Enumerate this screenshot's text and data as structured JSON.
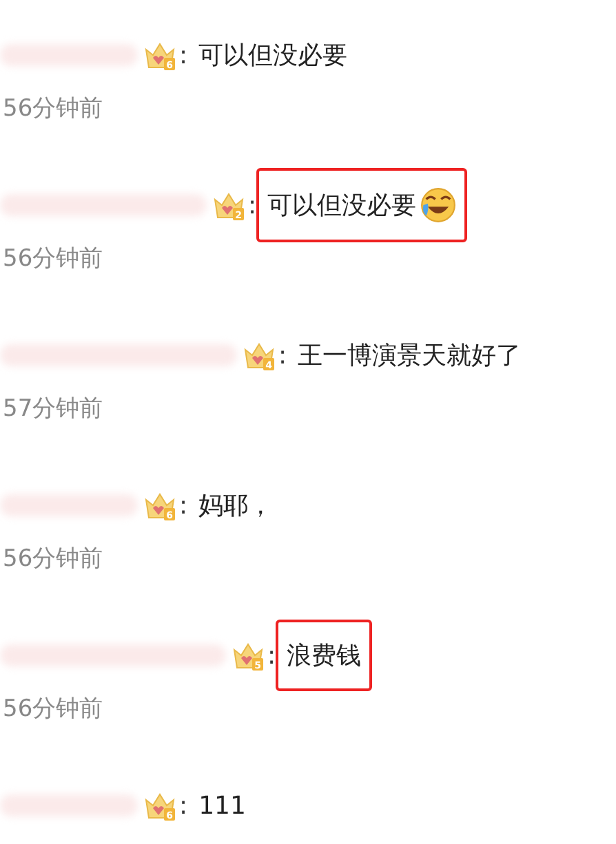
{
  "comments": [
    {
      "badge": "6",
      "separator": ":",
      "text": "可以但没必要",
      "highlighted": false,
      "time": "56分钟前"
    },
    {
      "badge": "2",
      "separator": ":",
      "text": "可以但没必要",
      "emoji": true,
      "highlighted": true,
      "time": "56分钟前"
    },
    {
      "badge": "4",
      "separator": ":",
      "text": "王一博演景天就好了",
      "highlighted": false,
      "time": "57分钟前"
    },
    {
      "badge": "6",
      "separator": ":",
      "text": "妈耶，",
      "highlighted": false,
      "time": "56分钟前"
    },
    {
      "badge": "5",
      "separator": ":",
      "text": "浪费钱",
      "highlighted": true,
      "time": "56分钟前"
    },
    {
      "badge": "6",
      "separator": ":",
      "text": "111",
      "highlighted": false
    }
  ]
}
